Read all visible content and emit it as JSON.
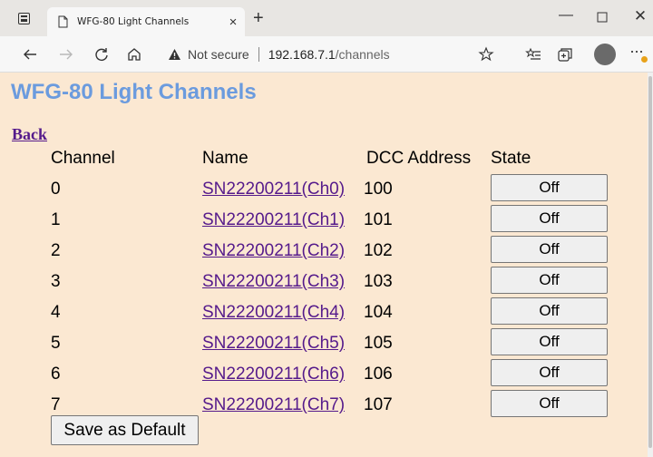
{
  "browser": {
    "tab_title": "WFG-80 Light Channels",
    "tab_close": "×",
    "new_tab": "+",
    "security_label": "Not secure",
    "url_host": "192.168.7.1",
    "url_path": "/channels",
    "window_min": "—",
    "window_close": "✕",
    "more": "···"
  },
  "page": {
    "title": "WFG-80 Light Channels",
    "back_link": "Back",
    "columns": {
      "channel": "Channel",
      "name": "Name",
      "address": "DCC Address",
      "state": "State"
    },
    "channels": [
      {
        "channel": "0",
        "name": "SN22200211(Ch0)",
        "address": "100",
        "state": "Off"
      },
      {
        "channel": "1",
        "name": "SN22200211(Ch1)",
        "address": "101",
        "state": "Off"
      },
      {
        "channel": "2",
        "name": "SN22200211(Ch2)",
        "address": "102",
        "state": "Off"
      },
      {
        "channel": "3",
        "name": "SN22200211(Ch3)",
        "address": "103",
        "state": "Off"
      },
      {
        "channel": "4",
        "name": "SN22200211(Ch4)",
        "address": "104",
        "state": "Off"
      },
      {
        "channel": "5",
        "name": "SN22200211(Ch5)",
        "address": "105",
        "state": "Off"
      },
      {
        "channel": "6",
        "name": "SN22200211(Ch6)",
        "address": "106",
        "state": "Off"
      },
      {
        "channel": "7",
        "name": "SN22200211(Ch7)",
        "address": "107",
        "state": "Off"
      }
    ],
    "save_label": "Save as Default"
  },
  "colors": {
    "page_background": "#fbe8d2",
    "heading": "#6b9bde",
    "link": "#551a8b"
  }
}
